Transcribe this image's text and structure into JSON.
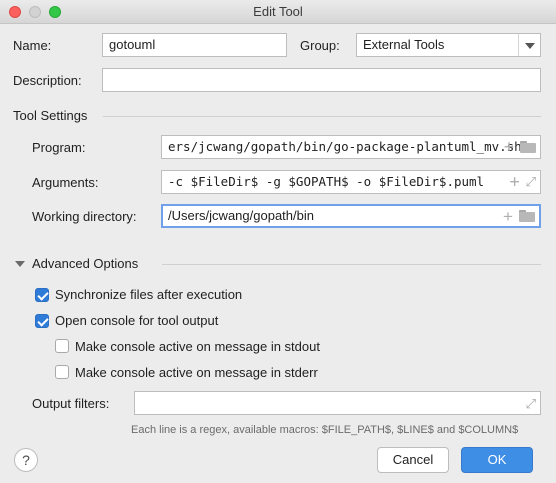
{
  "window": {
    "title": "Edit Tool"
  },
  "form": {
    "name_label": "Name:",
    "name_value": "gotouml",
    "group_label": "Group:",
    "group_value": "External Tools",
    "description_label": "Description:",
    "description_value": ""
  },
  "tool_settings": {
    "heading": "Tool Settings",
    "program_label": "Program:",
    "program_value": "ers/jcwang/gopath/bin/go-package-plantuml_mv.sh",
    "arguments_label": "Arguments:",
    "arguments_value": "-c $FileDir$ -g $GOPATH$ -o $FileDir$.puml",
    "workdir_label": "Working directory:",
    "workdir_value": "/Users/jcwang/gopath/bin"
  },
  "advanced": {
    "heading": "Advanced Options",
    "options": [
      {
        "label": "Synchronize files after execution",
        "checked": true
      },
      {
        "label": "Open console for tool output",
        "checked": true
      },
      {
        "label": "Make console active on message in stdout",
        "checked": false
      },
      {
        "label": "Make console active on message in stderr",
        "checked": false
      }
    ],
    "output_filters_label": "Output filters:",
    "output_filters_value": "",
    "hint": "Each line is a regex, available macros: $FILE_PATH$, $LINE$ and $COLUMN$"
  },
  "buttons": {
    "help": "?",
    "cancel": "Cancel",
    "ok": "OK"
  },
  "icons": {
    "add": "plus-icon",
    "browse": "folder-icon",
    "expand": "expand-icon"
  },
  "colors": {
    "accent": "#3f8ee6",
    "checkbox": "#2f7bd8",
    "focus_ring": "#6fa0e8"
  }
}
